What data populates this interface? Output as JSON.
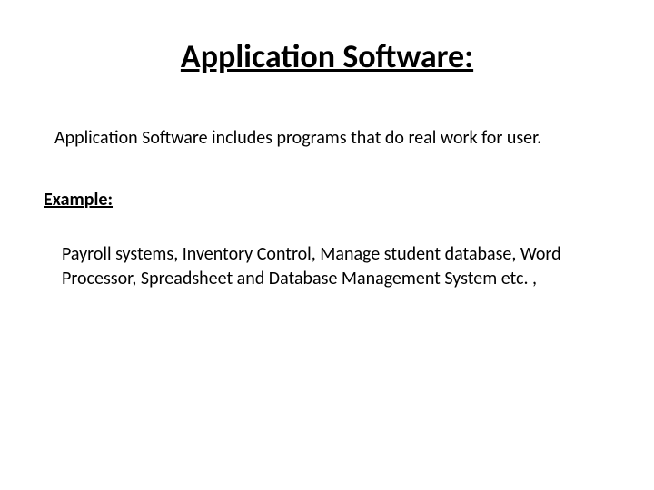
{
  "title": "Application Software:",
  "definition": "Application Software includes programs that do real work for user.",
  "example_label": "Example:",
  "example_body": "Payroll systems, Inventory Control, Manage student database, Word Processor, Spreadsheet and Database Management System etc. ,"
}
